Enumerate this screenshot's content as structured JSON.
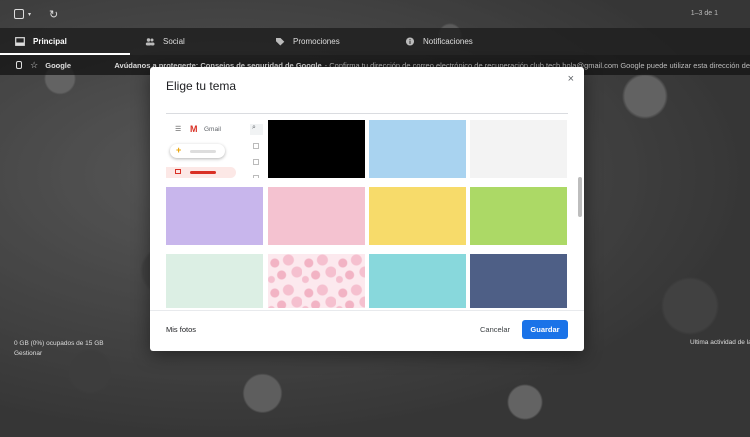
{
  "toolbar": {
    "range_text": "1–3 de 1"
  },
  "tabs": [
    {
      "label": "Principal",
      "icon": "inbox-icon",
      "active": true
    },
    {
      "label": "Social",
      "icon": "people-icon",
      "active": false
    },
    {
      "label": "Promociones",
      "icon": "tag-icon",
      "active": false
    },
    {
      "label": "Notificaciones",
      "icon": "info-icon",
      "active": false
    }
  ],
  "email": {
    "sender": "Google",
    "subject": "Avúdanos a protegerte: Consejos de seguridad de Google",
    "snippet": "- Confirma tu dirección de correo electrónico de recuperación club.tech.hola@gmail.com Google puede utilizar esta dirección de"
  },
  "footer": {
    "storage_line1": "0 GB (0%) ocupados de 15 GB",
    "storage_line2": "Gestionar",
    "last_activity": "Última actividad de la c"
  },
  "modal": {
    "title": "Elige tu tema",
    "close_glyph": "×",
    "my_photos": "Mis fotos",
    "cancel": "Cancelar",
    "save": "Guardar",
    "preview": {
      "menu_glyph": "☰",
      "logo_glyph": "M",
      "app_name": "Gmail",
      "compose_glyph": "+",
      "search_glyph": "⌕"
    },
    "swatches": [
      {
        "color": "#000000"
      },
      {
        "color": "#a9d3f0"
      },
      {
        "color": "#f3f3f3"
      },
      {
        "color": "#c8b6ec"
      },
      {
        "color": "#f4c2d0"
      },
      {
        "color": "#f7db6a"
      },
      {
        "color": "#acd966"
      },
      {
        "color": "#dcefe4"
      },
      {
        "color": "#fce9ee",
        "pattern": "floral-pink"
      },
      {
        "color": "#88d8dc"
      },
      {
        "color": "#4e5f86"
      }
    ]
  }
}
